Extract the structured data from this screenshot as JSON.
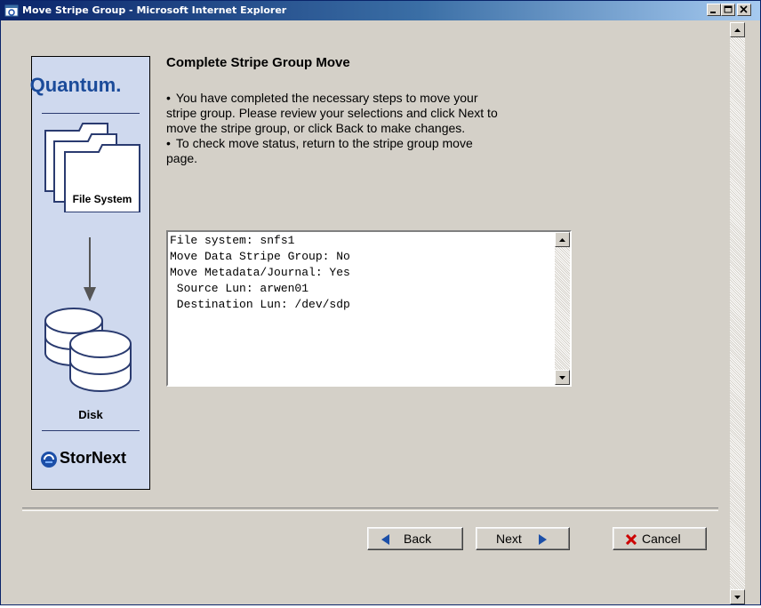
{
  "window": {
    "title": "Move Stripe Group - Microsoft Internet Explorer"
  },
  "sidebar": {
    "brand": "Quantum.",
    "folder_label": "File System",
    "disk_label": "Disk",
    "product": "StorNext"
  },
  "main": {
    "heading": "Complete Stripe Group Move",
    "instructions": [
      {
        "bullet": "•",
        "lines": [
          "You have completed the necessary steps to move your",
          "stripe group. Please review your selections and click Next to",
          "move the stripe group, or click Back to make changes."
        ]
      },
      {
        "bullet": "•",
        "lines": [
          "To check move status, return to the stripe group move",
          "page."
        ]
      }
    ],
    "summary_lines": [
      "File system: snfs1",
      "Move Data Stripe Group: No",
      "Move Metadata/Journal: Yes",
      " Source Lun: arwen01",
      " Destination Lun: /dev/sdp"
    ]
  },
  "buttons": {
    "back": "Back",
    "next": "Next",
    "cancel": "Cancel"
  },
  "colors": {
    "titlebar_start": "#0a246a",
    "sidebar_bg": "#cfd9ee",
    "brand_blue": "#1b4b9a",
    "cancel_red": "#cc0000",
    "arrow_blue": "#1c4fa8"
  }
}
